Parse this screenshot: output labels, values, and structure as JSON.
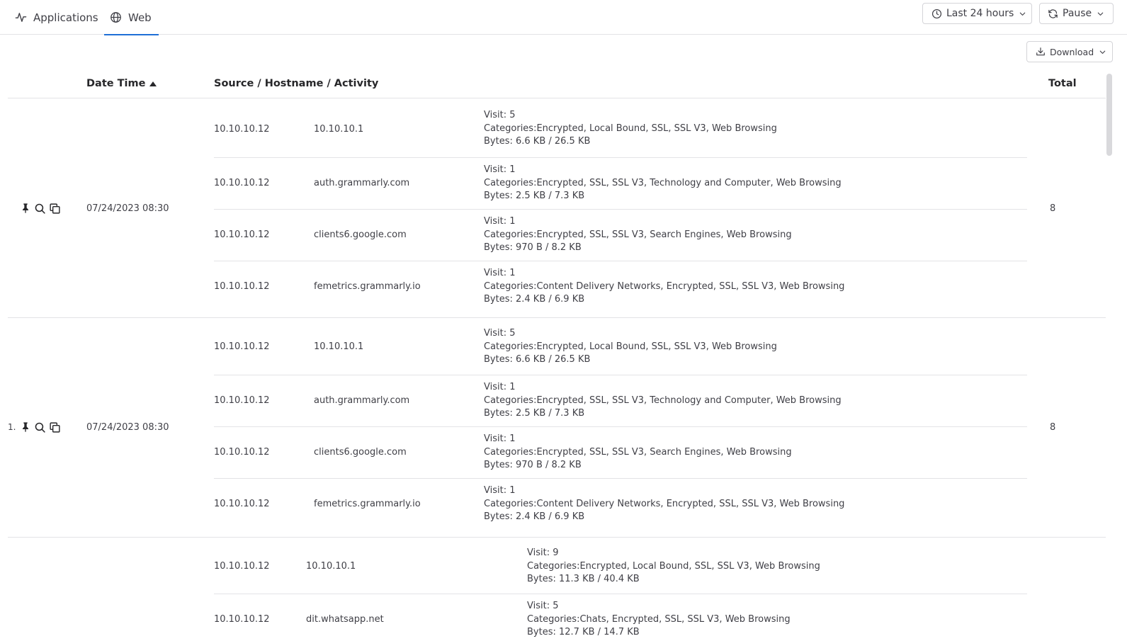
{
  "tabs": {
    "applications": "Applications",
    "web": "Web"
  },
  "toolbar": {
    "time_range": "Last 24 hours",
    "refresh": "Pause",
    "download": "Download"
  },
  "table": {
    "headers": {
      "date_time": "Date Time",
      "source_host_activity": "Source / Hostname / Activity",
      "total": "Total"
    },
    "groups": [
      {
        "row_number": "",
        "date_time": "07/24/2023 08:30",
        "total": "8",
        "entries": [
          {
            "source": "10.10.10.12",
            "hostname": "10.10.10.1",
            "visit": "Visit: 5",
            "categories": "Categories:Encrypted, Local Bound, SSL, SSL V3, Web Browsing",
            "bytes": "Bytes: 6.6 KB / 26.5 KB"
          },
          {
            "source": "10.10.10.12",
            "hostname": "auth.grammarly.com",
            "visit": "Visit: 1",
            "categories": "Categories:Encrypted, SSL, SSL V3, Technology and Computer, Web Browsing",
            "bytes": "Bytes: 2.5 KB / 7.3 KB"
          },
          {
            "source": "10.10.10.12",
            "hostname": "clients6.google.com",
            "visit": "Visit: 1",
            "categories": "Categories:Encrypted, SSL, SSL V3, Search Engines, Web Browsing",
            "bytes": "Bytes: 970 B / 8.2 KB"
          },
          {
            "source": "10.10.10.12",
            "hostname": "femetrics.grammarly.io",
            "visit": "Visit: 1",
            "categories": "Categories:Content Delivery Networks, Encrypted, SSL, SSL V3, Web Browsing",
            "bytes": "Bytes: 2.4 KB / 6.9 KB"
          }
        ]
      },
      {
        "row_number": "1.",
        "date_time": "07/24/2023 08:30",
        "total": "8",
        "entries": [
          {
            "source": "10.10.10.12",
            "hostname": "10.10.10.1",
            "visit": "Visit: 5",
            "categories": "Categories:Encrypted, Local Bound, SSL, SSL V3, Web Browsing",
            "bytes": "Bytes: 6.6 KB / 26.5 KB"
          },
          {
            "source": "10.10.10.12",
            "hostname": "auth.grammarly.com",
            "visit": "Visit: 1",
            "categories": "Categories:Encrypted, SSL, SSL V3, Technology and Computer, Web Browsing",
            "bytes": "Bytes: 2.5 KB / 7.3 KB"
          },
          {
            "source": "10.10.10.12",
            "hostname": "clients6.google.com",
            "visit": "Visit: 1",
            "categories": "Categories:Encrypted, SSL, SSL V3, Search Engines, Web Browsing",
            "bytes": "Bytes: 970 B / 8.2 KB"
          },
          {
            "source": "10.10.10.12",
            "hostname": "femetrics.grammarly.io",
            "visit": "Visit: 1",
            "categories": "Categories:Content Delivery Networks, Encrypted, SSL, SSL V3, Web Browsing",
            "bytes": "Bytes: 2.4 KB / 6.9 KB"
          }
        ]
      },
      {
        "row_number": "",
        "date_time": "",
        "total": "",
        "entries": [
          {
            "source": "10.10.10.12",
            "hostname": "10.10.10.1",
            "visit": "Visit: 9",
            "categories": "Categories:Encrypted, Local Bound, SSL, SSL V3, Web Browsing",
            "bytes": "Bytes: 11.3 KB / 40.4 KB"
          },
          {
            "source": "10.10.10.12",
            "hostname": "dit.whatsapp.net",
            "visit": "Visit: 5",
            "categories": "Categories:Chats, Encrypted, SSL, SSL V3, Web Browsing",
            "bytes": "Bytes: 12.7 KB / 14.7 KB"
          }
        ]
      }
    ]
  }
}
